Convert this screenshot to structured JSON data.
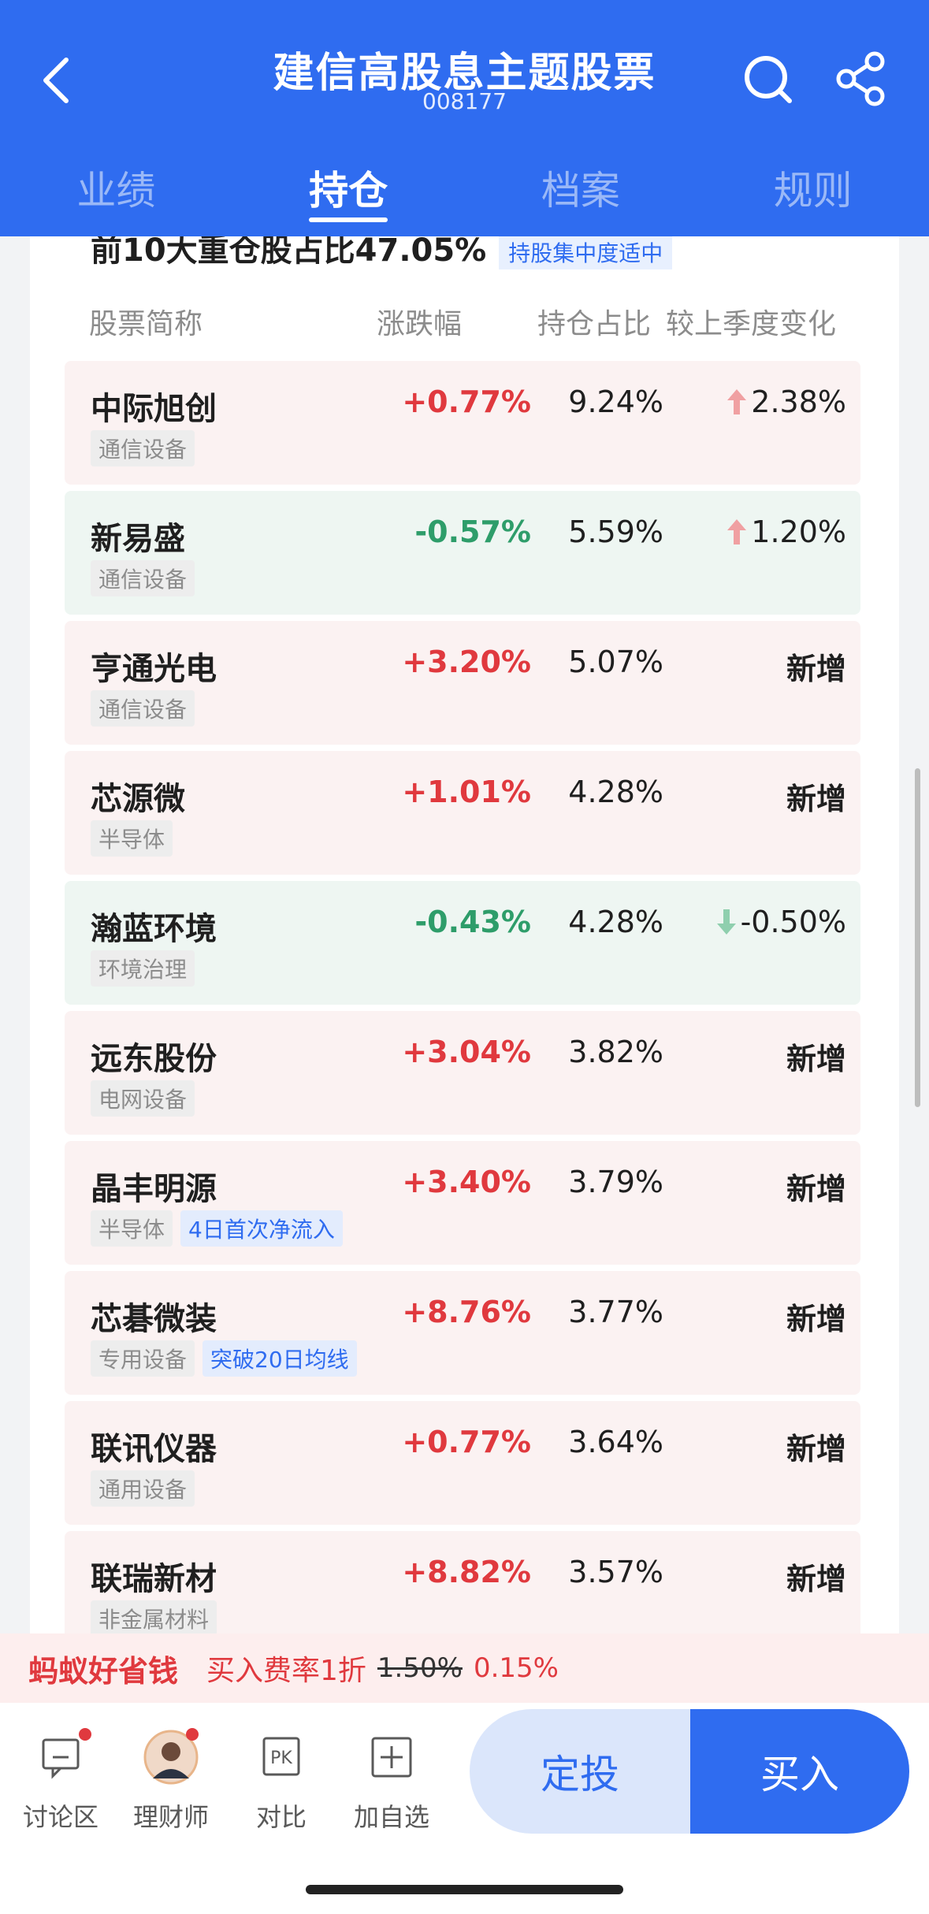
{
  "header": {
    "title": "建信高股息主题股票",
    "code": "008177",
    "tabs": [
      {
        "label": "业绩",
        "active": false
      },
      {
        "label": "持仓",
        "active": true
      },
      {
        "label": "档案",
        "active": false
      },
      {
        "label": "规则",
        "active": false
      }
    ],
    "accent_color": "#2f6cf0"
  },
  "holdings": {
    "summary": "前10大重仓股占比47.05%",
    "summary_tag": "持股集中度适中",
    "columns": [
      "股票简称",
      "涨跌幅",
      "持仓占比",
      "较上季度变化"
    ],
    "rows": [
      {
        "name": "中际旭创",
        "tags": [
          {
            "text": "通信设备",
            "type": "gray"
          }
        ],
        "change": "+0.77%",
        "direction": "up",
        "weight": "9.24%",
        "delta": "2.38%",
        "delta_icon": "arrow-up"
      },
      {
        "name": "新易盛",
        "tags": [
          {
            "text": "通信设备",
            "type": "gray"
          }
        ],
        "change": "-0.57%",
        "direction": "down",
        "weight": "5.59%",
        "delta": "1.20%",
        "delta_icon": "arrow-up"
      },
      {
        "name": "亨通光电",
        "tags": [
          {
            "text": "通信设备",
            "type": "gray"
          }
        ],
        "change": "+3.20%",
        "direction": "up",
        "weight": "5.07%",
        "delta": "新增",
        "delta_icon": ""
      },
      {
        "name": "芯源微",
        "tags": [
          {
            "text": "半导体",
            "type": "gray"
          }
        ],
        "change": "+1.01%",
        "direction": "up",
        "weight": "4.28%",
        "delta": "新增",
        "delta_icon": ""
      },
      {
        "name": "瀚蓝环境",
        "tags": [
          {
            "text": "环境治理",
            "type": "gray"
          }
        ],
        "change": "-0.43%",
        "direction": "down",
        "weight": "4.28%",
        "delta": "-0.50%",
        "delta_icon": "arrow-down"
      },
      {
        "name": "远东股份",
        "tags": [
          {
            "text": "电网设备",
            "type": "gray"
          }
        ],
        "change": "+3.04%",
        "direction": "up",
        "weight": "3.82%",
        "delta": "新增",
        "delta_icon": ""
      },
      {
        "name": "晶丰明源",
        "tags": [
          {
            "text": "半导体",
            "type": "gray"
          },
          {
            "text": "4日首次净流入",
            "type": "blue"
          }
        ],
        "change": "+3.40%",
        "direction": "up",
        "weight": "3.79%",
        "delta": "新增",
        "delta_icon": ""
      },
      {
        "name": "芯碁微装",
        "tags": [
          {
            "text": "专用设备",
            "type": "gray"
          },
          {
            "text": "突破20日均线",
            "type": "blue"
          }
        ],
        "change": "+8.76%",
        "direction": "up",
        "weight": "3.77%",
        "delta": "新增",
        "delta_icon": ""
      },
      {
        "name": "联讯仪器",
        "tags": [
          {
            "text": "通用设备",
            "type": "gray"
          }
        ],
        "change": "+0.77%",
        "direction": "up",
        "weight": "3.64%",
        "delta": "新增",
        "delta_icon": ""
      },
      {
        "name": "联瑞新材",
        "tags": [
          {
            "text": "非金属材料",
            "type": "gray"
          }
        ],
        "change": "+8.82%",
        "direction": "up",
        "weight": "3.57%",
        "delta": "新增",
        "delta_icon": ""
      }
    ]
  },
  "promo": {
    "brand": "蚂蚁好省钱",
    "text": "买入费率1折",
    "old_rate": "1.50%",
    "new_rate": "0.15%"
  },
  "bottom_bar": {
    "items": [
      {
        "label": "讨论区",
        "icon": "chat-icon",
        "dot": true
      },
      {
        "label": "理财师",
        "icon": "advisor-avatar",
        "dot": true
      },
      {
        "label": "对比",
        "icon": "pk-icon",
        "dot": false
      },
      {
        "label": "加自选",
        "icon": "plus-icon",
        "dot": false
      }
    ],
    "fixed_invest_label": "定投",
    "buy_label": "买入"
  }
}
